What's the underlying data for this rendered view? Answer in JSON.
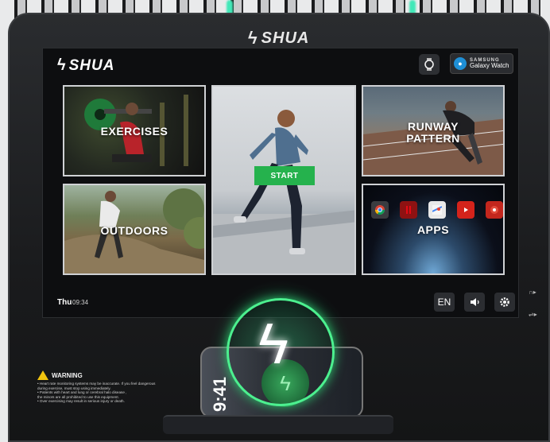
{
  "brand": "SHUA",
  "header": {
    "watch_icon": "smartwatch-icon",
    "galaxy_top": "SAMSUNG",
    "galaxy_bottom": "Galaxy Watch"
  },
  "tiles": {
    "exercises": "EXERCISES",
    "start": "START",
    "runway_line1": "RUNWAY",
    "runway_line2": "PATTERN",
    "outdoors": "OUTDOORS",
    "apps": "APPS"
  },
  "apps_icons": [
    "chrome-icon",
    "netflix-icon",
    "maps-icon",
    "youtube-icon",
    "music-icon"
  ],
  "status": {
    "day": "Thu",
    "time": "09:34",
    "language": "EN"
  },
  "warning": {
    "title": "WARNING",
    "lines": [
      "• Heart rate monitoring systems may be inaccurate.  If you feel dangerous",
      "   during exercise, must stop using immediately.",
      "• Patients with heart and lung or cerebral halo disease ,",
      "   the minors are all prohibited to use this equipment.",
      "• Over exercising may result in serious injury or death."
    ]
  },
  "phone": {
    "time": "9:41"
  },
  "colors": {
    "accent": "#25b24d",
    "glow": "#4cf08f",
    "warning": "#f1c40f"
  }
}
